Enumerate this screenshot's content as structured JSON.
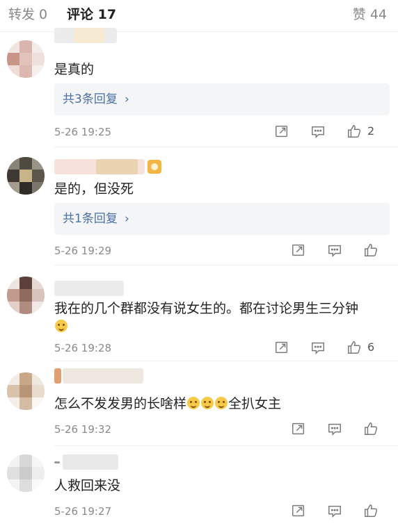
{
  "tabs": {
    "repost": "转发 0",
    "comment": "评论 17",
    "like": "赞 44"
  },
  "comments": [
    {
      "text": "是真的",
      "replies": "共3条回复",
      "chevron": "›",
      "time": "5-26 19:25",
      "likes": "2"
    },
    {
      "text": "是的，但没死",
      "replies": "共1条回复",
      "chevron": "›",
      "time": "5-26 19:29",
      "likes": ""
    },
    {
      "text": "我在的几个群都没有说女生的。都在讨论男生三分钟",
      "time": "5-26 19:28",
      "likes": "6"
    },
    {
      "text_a": "怎么不发发男的长啥样",
      "text_b": "全扒女主",
      "time": "5-26 19:32",
      "likes": ""
    },
    {
      "text": "人救回来没",
      "time": "5-26 19:27",
      "likes": ""
    }
  ],
  "icons": {
    "repost": "repost-icon",
    "comment": "comment-icon",
    "like": "thumbs-up-icon",
    "emoji": "smile-emoji-icon"
  },
  "colors": {
    "link": "#4a6fa5",
    "meta": "#8a8a8a",
    "accent": "#ff8200"
  }
}
